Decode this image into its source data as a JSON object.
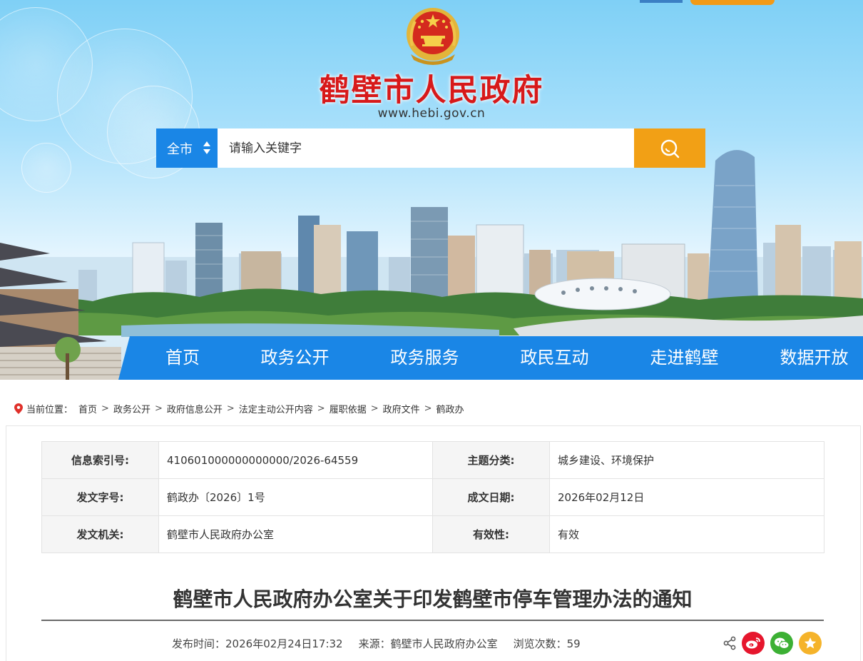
{
  "header": {
    "site_title": "鹤壁市人民政府",
    "site_url": "www.hebi.gov.cn",
    "emblem_icon": "national-emblem-icon"
  },
  "search": {
    "scope_label": "全市",
    "placeholder": "请输入关键字",
    "button_icon": "search-icon"
  },
  "nav": {
    "items": [
      {
        "label": "首页"
      },
      {
        "label": "政务公开"
      },
      {
        "label": "政务服务"
      },
      {
        "label": "政民互动"
      },
      {
        "label": "走进鹤壁"
      },
      {
        "label": "数据开放"
      }
    ]
  },
  "breadcrumb": {
    "prefix": "当前位置：",
    "items": [
      "首页",
      "政务公开",
      "政府信息公开",
      "法定主动公开内容",
      "履职依据",
      "政府文件",
      "鹤政办"
    ],
    "separator": ">"
  },
  "meta": {
    "index_no_label": "信息索引号:",
    "index_no": "410601000000000000/2026-64559",
    "topic_label": "主题分类:",
    "topic": "城乡建设、环境保护",
    "doc_no_label": "发文字号:",
    "doc_no": "鹤政办〔2026〕1号",
    "date_label": "成文日期:",
    "date": "2026年02月12日",
    "issuer_label": "发文机关:",
    "issuer": "鹤壁市人民政府办公室",
    "validity_label": "有效性:",
    "validity": "有效"
  },
  "article": {
    "title": "鹤壁市人民政府办公室关于印发鹤壁市停车管理办法的通知",
    "publish_label": "发布时间：",
    "publish_time": "2026年02月24日17:32",
    "source_label": "来源：",
    "source": "鹤壁市人民政府办公室",
    "views_label": "浏览次数：",
    "views": "59"
  },
  "share": {
    "icons": [
      "share-icon",
      "weibo-icon",
      "wechat-icon",
      "favorite-icon"
    ]
  },
  "colors": {
    "brand_blue": "#1a86e6",
    "accent_orange": "#f2a015",
    "title_red": "#d7191a"
  }
}
